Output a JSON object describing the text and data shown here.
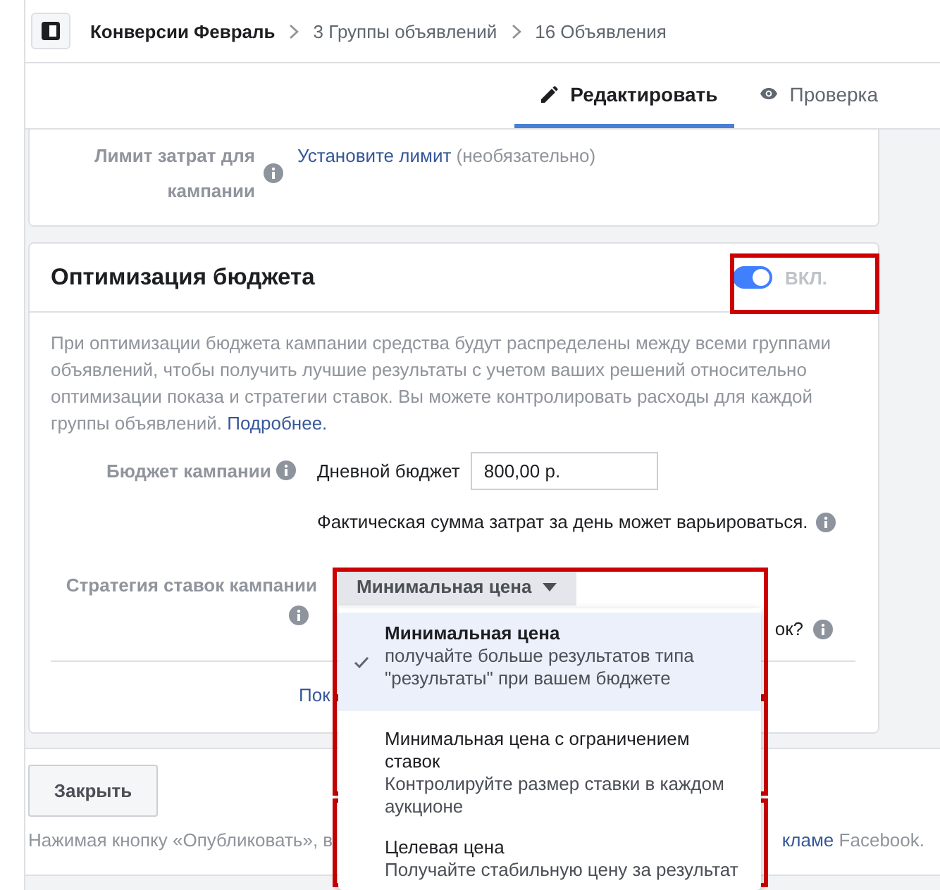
{
  "breadcrumbs": [
    {
      "label": "Конверсии Февраль",
      "current": true
    },
    {
      "label": "3 Группы объявлений",
      "current": false
    },
    {
      "label": "16 Объявления",
      "current": false
    }
  ],
  "tabs": [
    {
      "label": "Редактировать",
      "selected": true
    },
    {
      "label": "Проверка",
      "selected": false
    }
  ],
  "spend_limit": {
    "label": "Лимит затрат для кампании",
    "link": "Установите лимит",
    "note": "(необязательно)"
  },
  "budget_optimization": {
    "title": "Оптимизация бюджета",
    "toggle": {
      "on": true,
      "label": "ВКЛ."
    },
    "description": "При оптимизации бюджета кампании средства будут распределены между всеми группами объявлений, чтобы получить лучшие результаты с учетом ваших решений относительно оптимизации показа и стратегии ставок. Вы можете контролировать расходы для каждой группы объявлений.",
    "learn_more": "Подробнее.",
    "budget": {
      "label": "Бюджет кампании",
      "type": "Дневной бюджет",
      "value": "800,00 р.",
      "note": "Фактическая сумма затрат за день может варьироваться."
    },
    "bid_strategy": {
      "label": "Стратегия ставок кампании",
      "value": "Минимальная цена",
      "partial_question": "ок?"
    },
    "partial_link": "Пок"
  },
  "bid_menu": {
    "options": [
      {
        "title": "Минимальная цена",
        "description": "получайте больше результатов типа \"результаты\" при вашем бюджете",
        "selected": true
      },
      {
        "title": "Минимальная цена с ограничением ставок",
        "description": "Контролируйте размер ставки в каждом аукционе",
        "selected": false
      },
      {
        "title": "Целевая цена",
        "description": "Получайте стабильную цену за результат",
        "selected": false
      }
    ]
  },
  "footer": {
    "close_button": "Закрыть",
    "notice_start": "Нажимая кнопку «Опубликовать», в",
    "notice_link": "кламе",
    "notice_end": "Facebook."
  }
}
